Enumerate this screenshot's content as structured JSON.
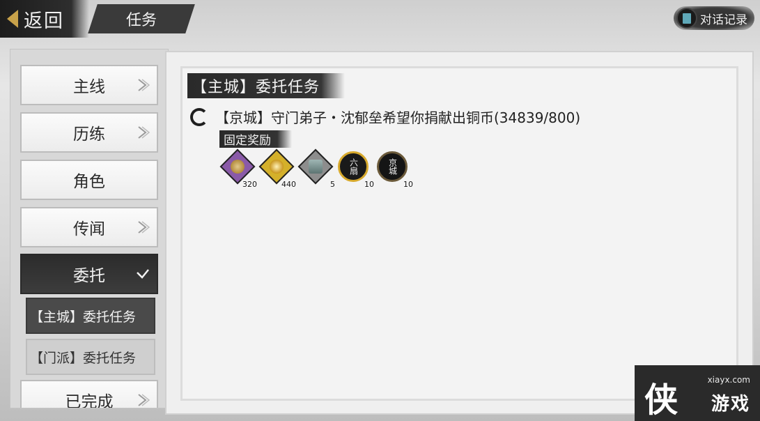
{
  "topbar": {
    "back_label": "返回",
    "title": "任务",
    "dialog_record_label": "对话记录"
  },
  "sidebar": {
    "items": [
      {
        "label": "主线",
        "has_arrow": true
      },
      {
        "label": "历练",
        "has_arrow": true
      },
      {
        "label": "角色",
        "has_arrow": false
      },
      {
        "label": "传闻",
        "has_arrow": true
      },
      {
        "label": "委托",
        "has_check": true,
        "active": true
      },
      {
        "label": "已完成",
        "has_arrow": true
      }
    ],
    "subitems": [
      {
        "label": "【主城】委托任务",
        "selected": true
      },
      {
        "label": "【门派】委托任务",
        "selected": false
      }
    ]
  },
  "panel": {
    "section_title": "【主城】委托任务",
    "task_text": "【京城】守门弟子・沈郁垒希望你捐献出铜币(34839/800)",
    "reward_header": "固定奖励",
    "rewards": [
      {
        "icon": "copper-coin-icon",
        "quantity": "320",
        "frame_color": "#8a5aa8"
      },
      {
        "icon": "gold-medal-icon",
        "quantity": "440",
        "frame_color": "#d4b02a"
      },
      {
        "icon": "bronze-vessel-icon",
        "quantity": "5",
        "frame_color": "#8d8d8d"
      },
      {
        "icon": "six-doors-badge-icon",
        "label": "六扇",
        "quantity": "10"
      },
      {
        "icon": "capital-badge-icon",
        "label": "京城",
        "quantity": "10"
      }
    ]
  },
  "watermark": {
    "url": "xiayx.com",
    "char": "侠",
    "text": "游戏"
  }
}
